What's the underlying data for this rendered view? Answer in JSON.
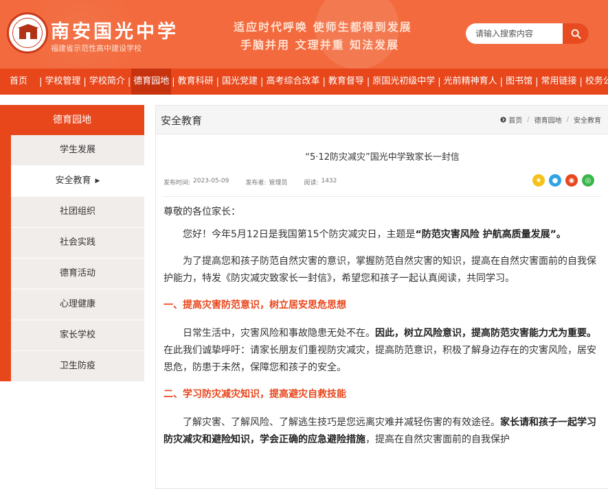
{
  "header": {
    "school_name": "南安国光中学",
    "school_sub": "福建省示范性高中建设学校",
    "slogan_line1": "适应时代呼唤  使师生都得到发展",
    "slogan_line2": "手脑并用  文理并重  知法发展",
    "search_placeholder": "请输入搜索内容"
  },
  "nav": {
    "items": [
      {
        "label": "首页"
      },
      {
        "label": "学校管理"
      },
      {
        "label": "学校简介"
      },
      {
        "label": "德育园地"
      },
      {
        "label": "教育科研"
      },
      {
        "label": "国光党建"
      },
      {
        "label": "高考综合改革"
      },
      {
        "label": "教育督导"
      },
      {
        "label": "原国光初级中学"
      },
      {
        "label": "光前精神育人"
      },
      {
        "label": "图书馆"
      },
      {
        "label": "常用链接"
      },
      {
        "label": "校务公开"
      }
    ],
    "active_index": 3
  },
  "sidebar": {
    "title": "德育园地",
    "items": [
      {
        "label": "学生发展"
      },
      {
        "label": "安全教育"
      },
      {
        "label": "社团组织"
      },
      {
        "label": "社会实践"
      },
      {
        "label": "德育活动"
      },
      {
        "label": "心理健康"
      },
      {
        "label": "家长学校"
      },
      {
        "label": "卫生防疫"
      }
    ],
    "active_index": 1
  },
  "content": {
    "section_title": "安全教育",
    "breadcrumb": {
      "home": "首页",
      "level1": "德育园地",
      "level2": "安全教育"
    },
    "article_title": "“5·12防灾减灾”国光中学致家长一封信",
    "meta": {
      "date_label": "发布时间:",
      "date": "2023-05-09",
      "author_label": "发布者:",
      "author": "管理员",
      "views_label": "阅读:",
      "views": "1432"
    },
    "greeting": "尊敬的各位家长：",
    "p1_normal": "您好！今年5月12日是我国第15个防灾减灾日，主题是",
    "p1_bold": "“防范灾害风险  护航高质量发展”。",
    "p2": "为了提高您和孩子防范自然灾害的意识，掌握防范自然灾害的知识，提高在自然灾害面前的自我保护能力，特发《防灾减灾致家长一封信》，希望您和孩子一起认真阅读，共同学习。",
    "h1": "一、提高灾害防范意识，树立居安思危思想",
    "p3_normal1": "日常生活中，灾害风险和事故隐患无处不在。",
    "p3_bold": "因此，树立风险意识，提高防范灾害能力尤为重要。",
    "p3_normal2": "在此我们诚挚呼吁：请家长朋友们重视防灾减灾，提高防范意识，积极了解身边存在的灾害风险，居安思危，防患于未然，保障您和孩子的安全。",
    "h2": "二、学习防灾减灾知识，提高避灾自救技能",
    "p4_normal1": "了解灾害、了解风险、了解逃生技巧是您远离灾难并减轻伤害的有效途径。",
    "p4_bold": "家长请和孩子一起学习防灾减灾和避险知识，学会正确的应急避险措施",
    "p4_normal2": "，提高在自然灾害面前的自我保护"
  },
  "share_icons": [
    "qzone-icon",
    "qq-icon",
    "weibo-icon",
    "wechat-icon"
  ],
  "colors": {
    "brand": "#e8461b",
    "header_bg": "#f26a3d",
    "section_heading": "#e8461b"
  }
}
